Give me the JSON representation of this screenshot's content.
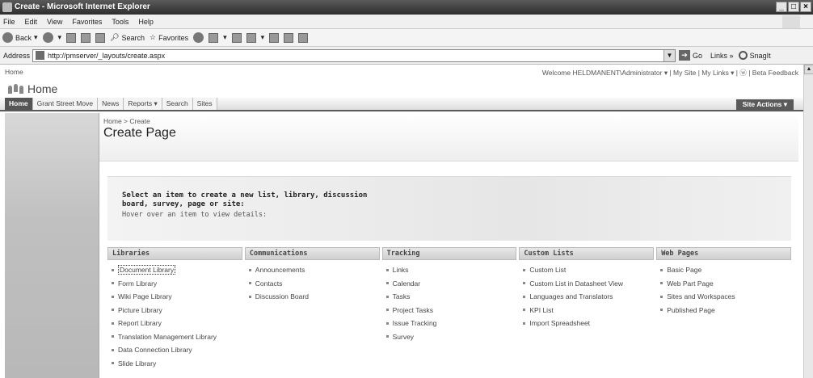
{
  "window": {
    "title": "Create - Microsoft Internet Explorer",
    "controls": [
      "_",
      "□",
      "×"
    ]
  },
  "menu": [
    "File",
    "Edit",
    "View",
    "Favorites",
    "Tools",
    "Help"
  ],
  "toolbar": {
    "back": "Back",
    "search": "Search",
    "favorites": "Favorites"
  },
  "address": {
    "label": "Address",
    "url": "http://pmserver/_layouts/create.aspx",
    "go": "Go",
    "links": "Links",
    "links_more": "»",
    "snagit": "SnagIt"
  },
  "sp": {
    "top_home": "Home",
    "welcome": "Welcome HELDMANENT\\Administrator ▾  |  My Site  |  My Links ▾  |  ⓦ  | Beta Feedback",
    "site_title": "Home",
    "tabs": [
      "Home",
      "Grant Street Move",
      "News",
      "Reports ▾",
      "Search",
      "Sites"
    ],
    "site_actions": "Site Actions ▾",
    "breadcrumb": "Home > Create",
    "page_title": "Create Page",
    "intro_title": "Select an item to create a new list, library, discussion board, survey, page or site:",
    "intro_hint": "Hover over an item to view details:",
    "columns": [
      {
        "heading": "Libraries",
        "items": [
          "Document Library",
          "Form Library",
          "Wiki Page Library",
          "Picture Library",
          "Report Library",
          "Translation Management Library",
          "Data Connection Library",
          "Slide Library"
        ]
      },
      {
        "heading": "Communications",
        "items": [
          "Announcements",
          "Contacts",
          "Discussion Board"
        ]
      },
      {
        "heading": "Tracking",
        "items": [
          "Links",
          "Calendar",
          "Tasks",
          "Project Tasks",
          "Issue Tracking",
          "Survey"
        ]
      },
      {
        "heading": "Custom Lists",
        "items": [
          "Custom List",
          "Custom List in Datasheet View",
          "Languages and Translators",
          "KPI List",
          "Import Spreadsheet"
        ]
      },
      {
        "heading": "Web Pages",
        "items": [
          "Basic Page",
          "Web Part Page",
          "Sites and Workspaces",
          "Published Page"
        ]
      }
    ]
  }
}
